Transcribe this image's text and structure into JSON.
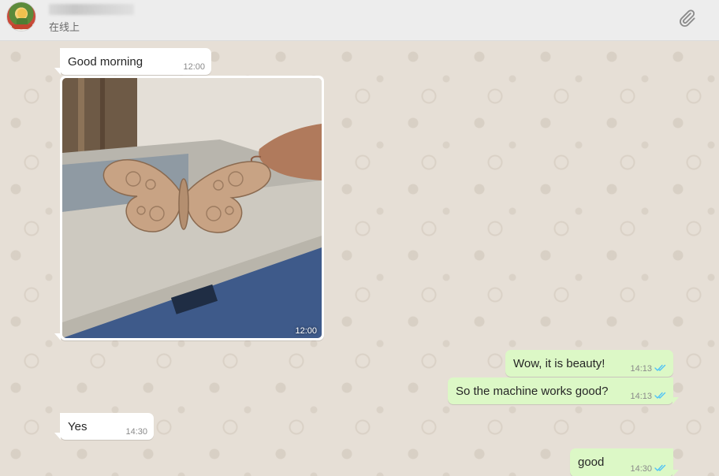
{
  "contact": {
    "status": "在线上"
  },
  "header": {
    "attach_icon": "paperclip-icon"
  },
  "messages": [
    {
      "direction": "incoming",
      "text": "Good morning",
      "time": "12:00"
    },
    {
      "direction": "incoming",
      "type": "image",
      "description": "Laser-cut wooden butterfly held above a laser cutting machine",
      "time": "12:00"
    },
    {
      "direction": "outgoing",
      "text": "Wow, it is beauty!",
      "time": "14:13",
      "status": "read"
    },
    {
      "direction": "outgoing",
      "text": "So the machine works good?",
      "time": "14:13",
      "status": "read"
    },
    {
      "direction": "incoming",
      "text": "Yes",
      "time": "14:30"
    },
    {
      "direction": "outgoing",
      "text": "good",
      "time": "14:30",
      "status": "read"
    }
  ],
  "colors": {
    "incoming_bubble": "#ffffff",
    "outgoing_bubble": "#dcf8c6",
    "read_ticks": "#4fc3f7",
    "chat_background": "#e6dfd6",
    "header_background": "#ededed"
  }
}
